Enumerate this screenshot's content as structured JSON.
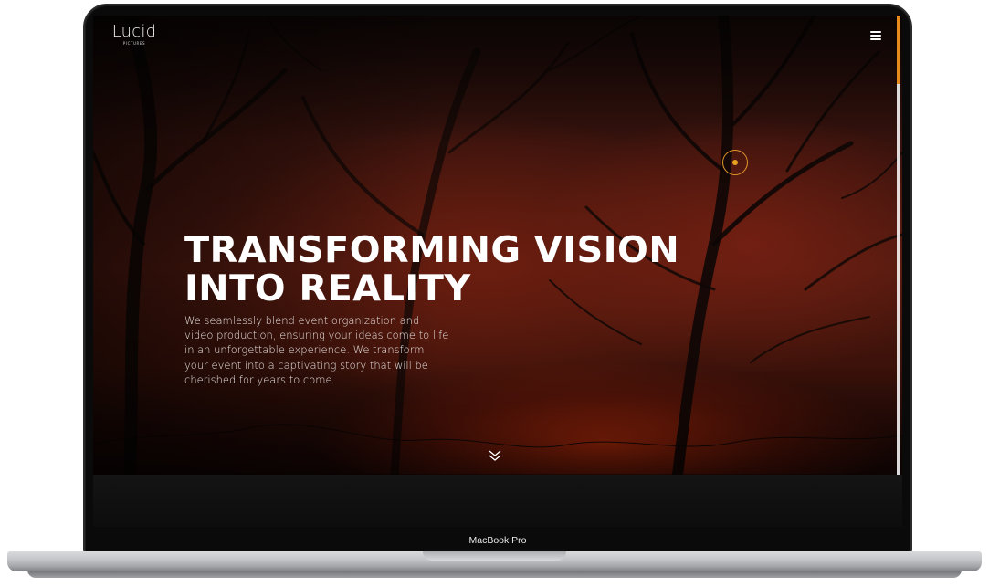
{
  "brand": {
    "name": "Lucid",
    "subtitle": "PICTURES"
  },
  "hero": {
    "headline_line1": "TRANSFORMING VISION",
    "headline_line2": "INTO REALITY",
    "description": "We seamlessly blend event organization and video production, ensuring your ideas come to life in an unforgettable experience. We transform your event into a captivating story that will be cherished for years to come."
  },
  "icons": {
    "menu": "hamburger-menu-icon",
    "scroll": "double-chevron-down-icon",
    "cursor": "cursor-ring-icon"
  },
  "scrollbar": {
    "position_fraction": 0.0,
    "thumb_color": "#e68a1c"
  },
  "device": {
    "label": "MacBook Pro"
  },
  "colors": {
    "accent": "#e68a1c",
    "text": "#ffffff",
    "background": "#0a0a0a"
  }
}
